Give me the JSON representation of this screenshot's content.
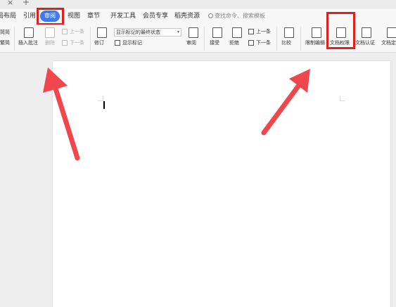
{
  "window": {
    "close_symbol": "×",
    "new_tab_symbol": "+"
  },
  "menu": {
    "tabs": [
      {
        "label": "局布局"
      },
      {
        "label": "引用"
      },
      {
        "label": "审阅"
      },
      {
        "label": "视图"
      },
      {
        "label": "章节"
      },
      {
        "label": "开发工具"
      },
      {
        "label": "会员专享"
      },
      {
        "label": "稻壳资源"
      }
    ],
    "active_tab": "审阅",
    "search_placeholder": "查找命令、搜索模板"
  },
  "ribbon": {
    "left_stub_top": "简简",
    "left_stub_bottom": "繁简",
    "insert_comment": "插入批注",
    "delete": "删除",
    "previous_comment": "上一条",
    "next_comment": "下一条",
    "display_state_value": "显示标记的最终状态",
    "track_changes": "修订",
    "show_markup": "显示标记",
    "review": "审阅",
    "accept": "接受",
    "reject": "拒绝",
    "previous_change": "上一条",
    "next_change": "下一条",
    "compare": "比较",
    "restrict_editing": "限制编辑",
    "document_permissions": "文档权限",
    "document_certification": "文档认证",
    "document_final": "文档定"
  },
  "colors": {
    "accent": "#3e7bf2",
    "highlight": "#e01f1f",
    "arrow": "#f0474c"
  },
  "icons": [
    "close-icon",
    "plus-icon",
    "search-icon",
    "insert-comment-icon",
    "delete-comment-icon",
    "track-changes-icon",
    "review-pane-icon",
    "accept-icon",
    "reject-icon",
    "compare-icon",
    "restrict-editing-icon",
    "document-permissions-icon",
    "document-certification-icon",
    "document-final-icon"
  ]
}
